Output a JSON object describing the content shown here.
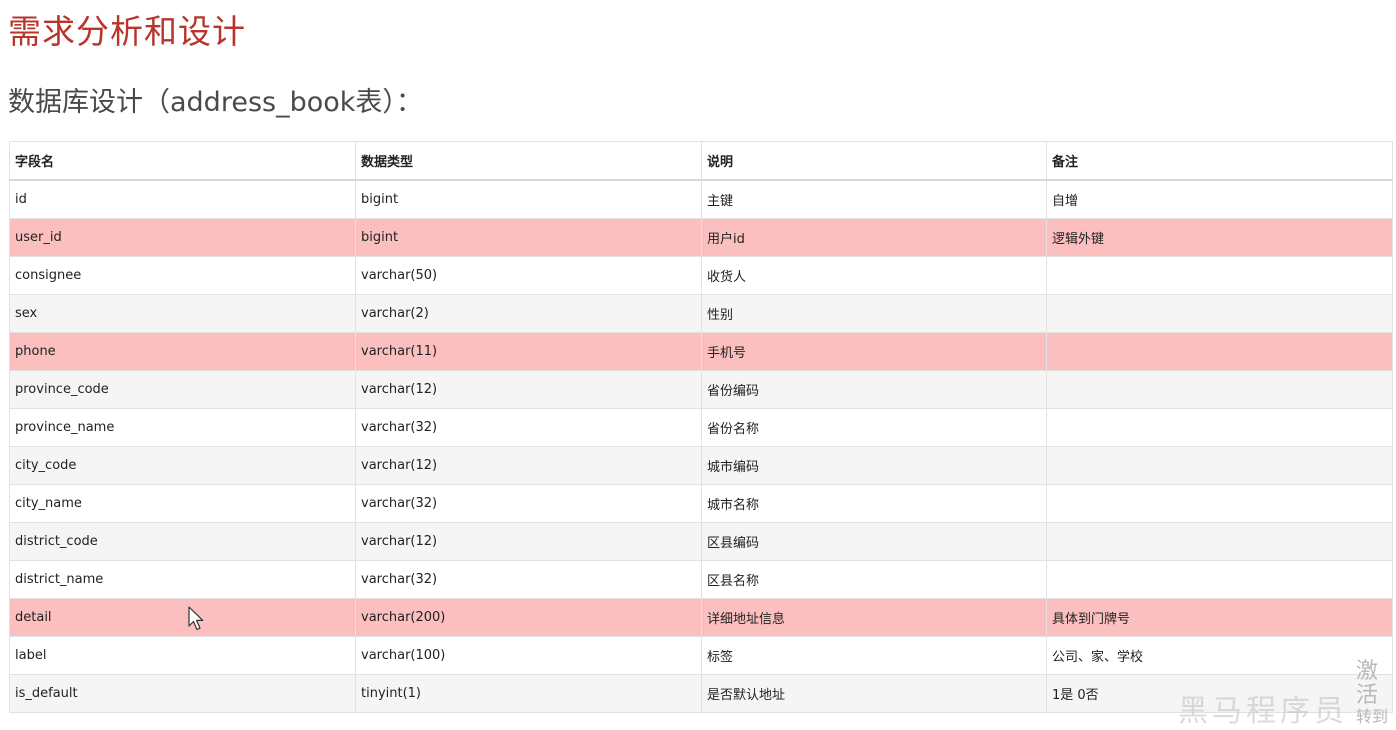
{
  "page": {
    "title": "需求分析和设计",
    "subtitle": "数据库设计（address_book表）："
  },
  "table": {
    "headers": [
      "字段名",
      "数据类型",
      "说明",
      "备注"
    ],
    "rows": [
      {
        "field": "id",
        "type": "bigint",
        "desc": "主键",
        "note": "自增",
        "highlight": false
      },
      {
        "field": "user_id",
        "type": "bigint",
        "desc": "用户id",
        "note": "逻辑外键",
        "highlight": true
      },
      {
        "field": "consignee",
        "type": "varchar(50)",
        "desc": "收货人",
        "note": "",
        "highlight": false
      },
      {
        "field": "sex",
        "type": "varchar(2)",
        "desc": "性别",
        "note": "",
        "highlight": false
      },
      {
        "field": "phone",
        "type": "varchar(11)",
        "desc": "手机号",
        "note": "",
        "highlight": true
      },
      {
        "field": "province_code",
        "type": "varchar(12)",
        "desc": "省份编码",
        "note": "",
        "highlight": false
      },
      {
        "field": "province_name",
        "type": "varchar(32)",
        "desc": "省份名称",
        "note": "",
        "highlight": false
      },
      {
        "field": "city_code",
        "type": "varchar(12)",
        "desc": "城市编码",
        "note": "",
        "highlight": false
      },
      {
        "field": "city_name",
        "type": "varchar(32)",
        "desc": "城市名称",
        "note": "",
        "highlight": false
      },
      {
        "field": "district_code",
        "type": "varchar(12)",
        "desc": "区县编码",
        "note": "",
        "highlight": false
      },
      {
        "field": "district_name",
        "type": "varchar(32)",
        "desc": "区县名称",
        "note": "",
        "highlight": false
      },
      {
        "field": "detail",
        "type": "varchar(200)",
        "desc": "详细地址信息",
        "note": "具体到门牌号",
        "highlight": true
      },
      {
        "field": "label",
        "type": "varchar(100)",
        "desc": "标签",
        "note": "公司、家、学校",
        "highlight": false
      },
      {
        "field": "is_default",
        "type": "tinyint(1)",
        "desc": "是否默认地址",
        "note": "1是 0否",
        "highlight": false
      }
    ]
  },
  "overlay": {
    "watermark": "黑马程序员",
    "activate_line1": "激活",
    "activate_line2": "转到"
  },
  "colors": {
    "title": "#b7352a",
    "highlight_row": "#fbbfbf",
    "alt_row": "#f5f5f5"
  },
  "icons": {
    "cursor": "mouse-pointer-icon"
  }
}
